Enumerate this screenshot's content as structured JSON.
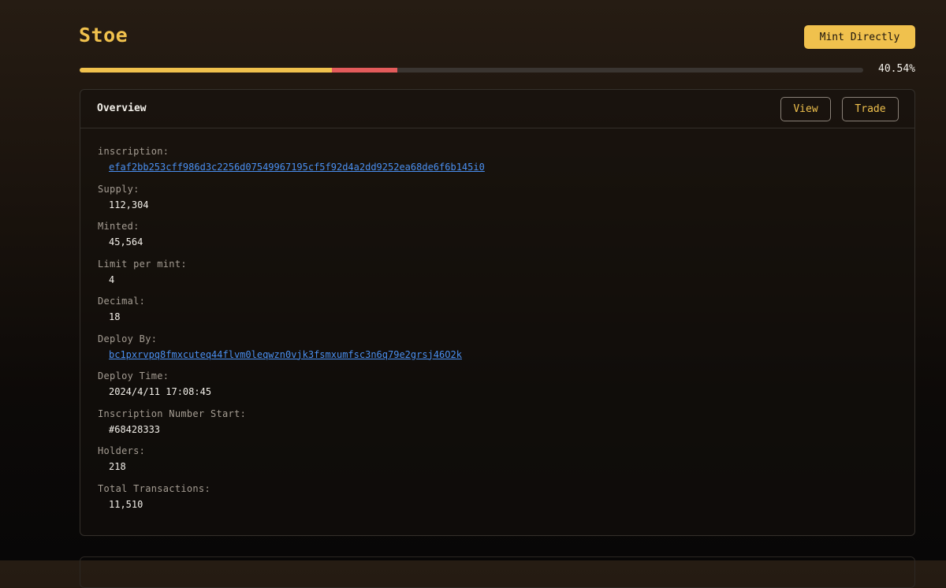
{
  "header": {
    "title": "Stoe",
    "mint_button_label": "Mint Directly"
  },
  "progress": {
    "percent_label": "40.54%",
    "minted_fraction": 0.3224,
    "pending_fraction": 0.0826,
    "colors": {
      "minted": "#f0c14d",
      "pending": "#e35b5b",
      "track": "#3a3531"
    }
  },
  "overview": {
    "title": "Overview",
    "view_label": "View",
    "trade_label": "Trade",
    "fields": [
      {
        "label": "inscription:",
        "value": "efaf2bb253cff986d3c2256d07549967195cf5f92d4a2dd9252ea68de6f6b145i0",
        "is_link": true
      },
      {
        "label": "Supply:",
        "value": "112,304",
        "is_link": false
      },
      {
        "label": "Minted:",
        "value": "45,564",
        "is_link": false
      },
      {
        "label": "Limit per mint:",
        "value": "4",
        "is_link": false
      },
      {
        "label": "Decimal:",
        "value": "18",
        "is_link": false
      },
      {
        "label": "Deploy By:",
        "value": "bc1pxrvpq8fmxcuteq44flvm0leqwzn0vjk3fsmxumfsc3n6q79e2grsj46O2k",
        "is_link": true
      },
      {
        "label": "Deploy Time:",
        "value": "2024/4/11 17:08:45",
        "is_link": false
      },
      {
        "label": "Inscription Number Start:",
        "value": "#68428333",
        "is_link": false
      },
      {
        "label": "Holders:",
        "value": "218",
        "is_link": false
      },
      {
        "label": "Total Transactions:",
        "value": "11,510",
        "is_link": false
      }
    ]
  },
  "theme": {
    "accent": "#f0c14d",
    "link": "#4a8ff0",
    "border": "#34302b"
  }
}
